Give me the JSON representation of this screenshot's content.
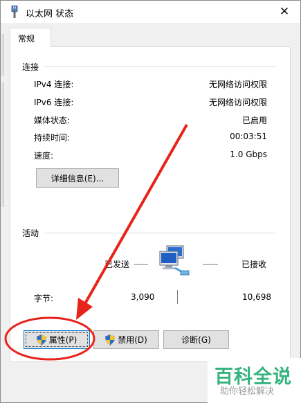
{
  "window": {
    "title": "以太网 状态",
    "close_glyph": "✕"
  },
  "tabs": [
    {
      "label": "常规"
    }
  ],
  "connection": {
    "group_label": "连接",
    "rows": [
      {
        "label": "IPv4 连接:",
        "value": "无网络访问权限"
      },
      {
        "label": "IPv6 连接:",
        "value": "无网络访问权限"
      },
      {
        "label": "媒体状态:",
        "value": "已启用"
      },
      {
        "label": "持续时间:",
        "value": "00:03:51"
      },
      {
        "label": "速度:",
        "value": "1.0 Gbps"
      }
    ],
    "details_button": "详细信息(E)..."
  },
  "activity": {
    "group_label": "活动",
    "sent_label": "已发送",
    "received_label": "已接收",
    "bytes_label": "字节:",
    "bytes_sent": "3,090",
    "bytes_received": "10,698",
    "network_icon": "network-computers-icon"
  },
  "buttons": {
    "properties": "属性(P)",
    "disable": "禁用(D)",
    "diagnose": "诊断(G)"
  },
  "watermark": {
    "title": "百科全说",
    "subtitle": "助你轻松解决"
  },
  "colors": {
    "annotation_red": "#e8231b",
    "watermark_green": "#36b37e",
    "focus_blue": "#0078d7"
  }
}
